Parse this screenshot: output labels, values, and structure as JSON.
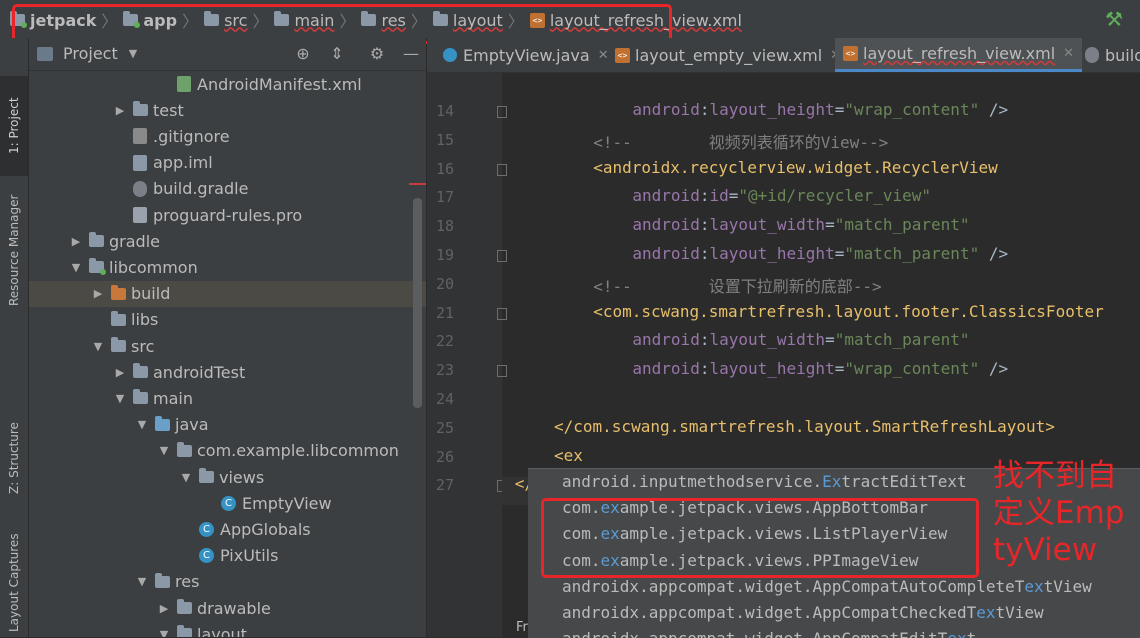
{
  "breadcrumb": {
    "items": [
      {
        "label": "jetpack",
        "icon": "module-folder-icon",
        "bold": true,
        "underline": false
      },
      {
        "label": "app",
        "icon": "module-folder-icon",
        "bold": true,
        "underline": false
      },
      {
        "label": "src",
        "icon": "folder-icon",
        "bold": false,
        "underline": true
      },
      {
        "label": "main",
        "icon": "folder-icon",
        "bold": false,
        "underline": true
      },
      {
        "label": "res",
        "icon": "resource-folder-icon",
        "bold": false,
        "underline": true
      },
      {
        "label": "layout",
        "icon": "folder-icon",
        "bold": false,
        "underline": true
      },
      {
        "label": "layout_refresh_view.xml",
        "icon": "xml-file-icon",
        "bold": false,
        "underline": true
      }
    ],
    "build_icon": "hammer-icon"
  },
  "toolstrip": {
    "tabs": [
      "1: Project",
      "Resource Manager",
      "Z: Structure",
      "Layout Captures"
    ]
  },
  "project_panel": {
    "title": "Project",
    "dropdown_icon": "chevron-down-icon",
    "header_icons": [
      "target-icon",
      "collapse-icon",
      "gear-icon",
      "minimize-icon"
    ],
    "tree": [
      {
        "label": "AndroidManifest.xml",
        "indent": 5,
        "arrow": "",
        "icon": "manifest",
        "selected": false
      },
      {
        "label": "test",
        "indent": 3,
        "arrow": "▶",
        "icon": "folder",
        "selected": false
      },
      {
        "label": ".gitignore",
        "indent": 3,
        "arrow": "",
        "icon": "ignore",
        "selected": false
      },
      {
        "label": "app.iml",
        "indent": 3,
        "arrow": "",
        "icon": "iml",
        "selected": false
      },
      {
        "label": "build.gradle",
        "indent": 3,
        "arrow": "",
        "icon": "gradle",
        "selected": false
      },
      {
        "label": "proguard-rules.pro",
        "indent": 3,
        "arrow": "",
        "icon": "pro",
        "selected": false
      },
      {
        "label": "gradle",
        "indent": 1,
        "arrow": "▶",
        "icon": "folder",
        "selected": false
      },
      {
        "label": "libcommon",
        "indent": 1,
        "arrow": "▼",
        "icon": "module",
        "selected": false
      },
      {
        "label": "build",
        "indent": 2,
        "arrow": "▶",
        "icon": "folder-orange",
        "selected": true
      },
      {
        "label": "libs",
        "indent": 2,
        "arrow": "",
        "icon": "folder",
        "selected": false
      },
      {
        "label": "src",
        "indent": 2,
        "arrow": "▼",
        "icon": "folder",
        "selected": false
      },
      {
        "label": "androidTest",
        "indent": 3,
        "arrow": "▶",
        "icon": "folder",
        "selected": false
      },
      {
        "label": "main",
        "indent": 3,
        "arrow": "▼",
        "icon": "folder",
        "selected": false
      },
      {
        "label": "java",
        "indent": 4,
        "arrow": "▼",
        "icon": "folder-blue",
        "selected": false
      },
      {
        "label": "com.example.libcommon",
        "indent": 5,
        "arrow": "▼",
        "icon": "folder",
        "selected": false
      },
      {
        "label": "views",
        "indent": 6,
        "arrow": "▼",
        "icon": "folder",
        "selected": false
      },
      {
        "label": "EmptyView",
        "indent": 7,
        "arrow": "",
        "icon": "class",
        "selected": false
      },
      {
        "label": "AppGlobals",
        "indent": 6,
        "arrow": "",
        "icon": "class",
        "selected": false
      },
      {
        "label": "PixUtils",
        "indent": 6,
        "arrow": "",
        "icon": "class",
        "selected": false
      },
      {
        "label": "res",
        "indent": 4,
        "arrow": "▼",
        "icon": "folder",
        "selected": false
      },
      {
        "label": "drawable",
        "indent": 5,
        "arrow": "▶",
        "icon": "folder",
        "selected": false
      },
      {
        "label": "layout",
        "indent": 5,
        "arrow": "▼",
        "icon": "folder",
        "selected": false
      }
    ]
  },
  "editor": {
    "tabs": [
      {
        "label": "EmptyView.java",
        "icon": "java-class-icon",
        "active": false
      },
      {
        "label": "layout_empty_view.xml",
        "icon": "xml-file-icon",
        "active": false
      },
      {
        "label": "layout_refresh_view.xml",
        "icon": "xml-file-icon",
        "active": true
      },
      {
        "label": "build",
        "icon": "gradle-icon",
        "active": false
      }
    ],
    "lines": [
      {
        "n": "14",
        "indent": 8,
        "tokens": [
          [
            "ns",
            "android"
          ],
          [
            "plain",
            ":"
          ],
          [
            "attr",
            "layout_height"
          ],
          [
            "plain",
            "="
          ],
          [
            "val",
            "\"wrap_content\""
          ],
          [
            "plain",
            " />"
          ]
        ]
      },
      {
        "n": "15",
        "indent": 4,
        "tokens": [
          [
            "cmt",
            "<!--        视频列表循环的View-->"
          ]
        ]
      },
      {
        "n": "16",
        "indent": 4,
        "tokens": [
          [
            "tag",
            "<androidx.recyclerview.widget.RecyclerView"
          ]
        ]
      },
      {
        "n": "17",
        "indent": 8,
        "tokens": [
          [
            "ns",
            "android"
          ],
          [
            "plain",
            ":"
          ],
          [
            "attr",
            "id"
          ],
          [
            "plain",
            "="
          ],
          [
            "val",
            "\"@+id/recycler_view\""
          ]
        ]
      },
      {
        "n": "18",
        "indent": 8,
        "tokens": [
          [
            "ns",
            "android"
          ],
          [
            "plain",
            ":"
          ],
          [
            "attr",
            "layout_width"
          ],
          [
            "plain",
            "="
          ],
          [
            "val",
            "\"match_parent\""
          ]
        ]
      },
      {
        "n": "19",
        "indent": 8,
        "tokens": [
          [
            "ns",
            "android"
          ],
          [
            "plain",
            ":"
          ],
          [
            "attr",
            "layout_height"
          ],
          [
            "plain",
            "="
          ],
          [
            "val",
            "\"match_parent\""
          ],
          [
            "plain",
            " />"
          ]
        ]
      },
      {
        "n": "20",
        "indent": 4,
        "tokens": [
          [
            "cmt",
            "<!--        设置下拉刷新的底部-->"
          ]
        ]
      },
      {
        "n": "21",
        "indent": 4,
        "tokens": [
          [
            "tag",
            "<com.scwang.smartrefresh.layout.footer.ClassicsFooter"
          ]
        ]
      },
      {
        "n": "22",
        "indent": 8,
        "tokens": [
          [
            "ns",
            "android"
          ],
          [
            "plain",
            ":"
          ],
          [
            "attr",
            "layout_width"
          ],
          [
            "plain",
            "="
          ],
          [
            "val",
            "\"match_parent\""
          ]
        ]
      },
      {
        "n": "23",
        "indent": 8,
        "tokens": [
          [
            "ns",
            "android"
          ],
          [
            "plain",
            ":"
          ],
          [
            "attr",
            "layout_height"
          ],
          [
            "plain",
            "="
          ],
          [
            "val",
            "\"wrap_content\""
          ],
          [
            "plain",
            " />"
          ]
        ]
      },
      {
        "n": "24",
        "indent": 0,
        "tokens": []
      },
      {
        "n": "25",
        "indent": 0,
        "tokens": [
          [
            "tag",
            "</com.scwang.smartrefresh.layout.SmartRefreshLayout>"
          ]
        ]
      },
      {
        "n": "26",
        "indent": 0,
        "tokens": [
          [
            "tag",
            "<ex"
          ]
        ]
      },
      {
        "n": "27",
        "indent": -4,
        "tokens": [
          [
            "tag",
            "</"
          ]
        ]
      }
    ]
  },
  "completion": {
    "query": "ex",
    "items": [
      {
        "pre": "android.inputmethodservice.",
        "match": "Ex",
        "post": "tractEditText"
      },
      {
        "pre": "com.",
        "match": "ex",
        "post": "ample.jetpack.views.AppBottomBar"
      },
      {
        "pre": "com.",
        "match": "ex",
        "post": "ample.jetpack.views.ListPlayerView"
      },
      {
        "pre": "com.",
        "match": "ex",
        "post": "ample.jetpack.views.PPImageView"
      },
      {
        "pre": "androidx.appcompat.widget.AppCompatAutoCompleteT",
        "match": "ex",
        "post": "tView"
      },
      {
        "pre": "androidx.appcompat.widget.AppCompatCheckedT",
        "match": "ex",
        "post": "tView"
      },
      {
        "pre": "androidx.appcompat.widget.AppCompatEditT",
        "match": "ex",
        "post": "t"
      }
    ]
  },
  "annotation": {
    "text": "找不到自定义EmptyView",
    "color": "#e8262a"
  },
  "footer": {
    "label": "Fr"
  }
}
